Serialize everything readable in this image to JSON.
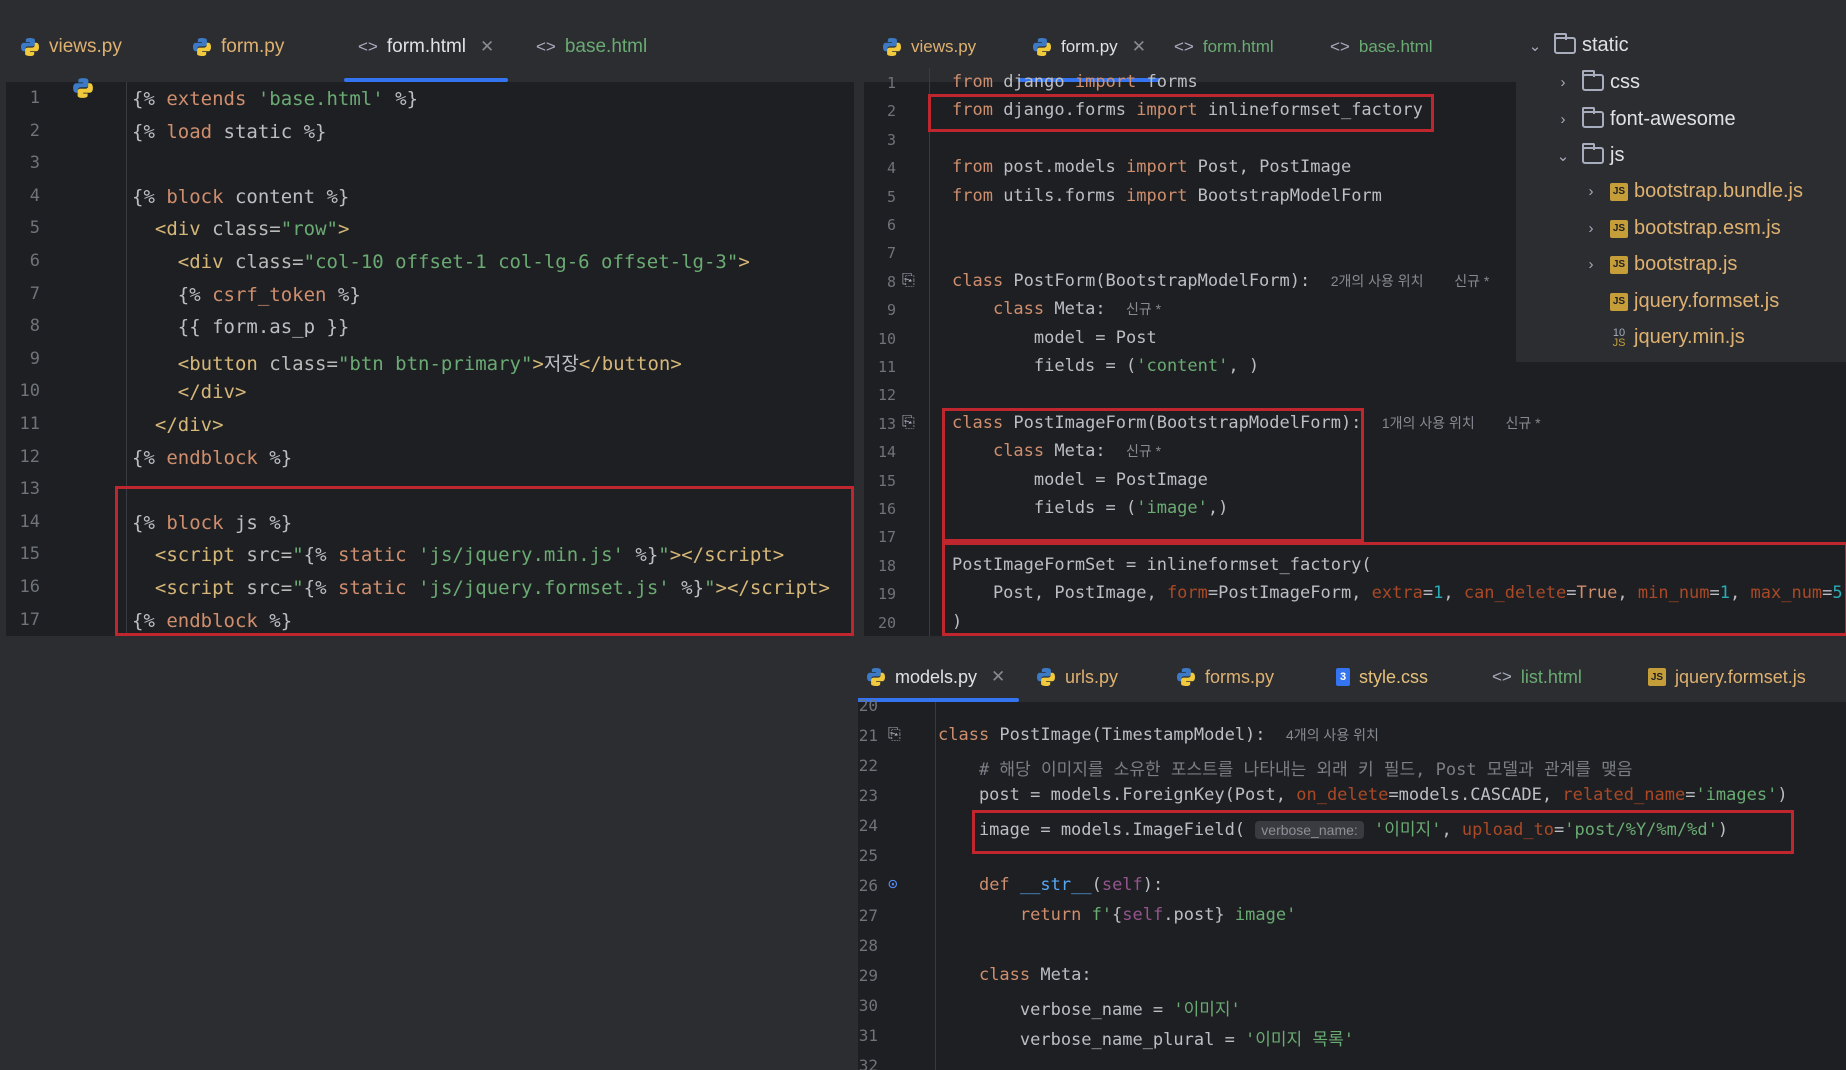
{
  "left": {
    "tabs": [
      {
        "label": "views.py",
        "icon": "python-icon"
      },
      {
        "label": "form.py",
        "icon": "python-icon"
      },
      {
        "label": "form.html",
        "icon": "html-icon",
        "active": true,
        "closable": true
      },
      {
        "label": "base.html",
        "icon": "html-icon"
      }
    ],
    "line_numbers": [
      "1",
      "2",
      "3",
      "4",
      "5",
      "6",
      "7",
      "8",
      "9",
      "10",
      "11",
      "12",
      "13",
      "14",
      "15",
      "16",
      "17"
    ]
  },
  "right_top": {
    "tabs": [
      {
        "label": "views.py",
        "icon": "python-icon"
      },
      {
        "label": "form.py",
        "icon": "python-icon",
        "active": true,
        "closable": true
      },
      {
        "label": "form.html",
        "icon": "html-icon"
      },
      {
        "label": "base.html",
        "icon": "html-icon"
      }
    ],
    "line_numbers": [
      "1",
      "2",
      "3",
      "4",
      "5",
      "6",
      "7",
      "8",
      "9",
      "10",
      "11",
      "12",
      "13",
      "14",
      "15",
      "16",
      "17",
      "18",
      "19",
      "20"
    ],
    "hints": {
      "postform_usages": "2개의 사용 위치",
      "postform_new": "신규 *",
      "meta_new_1": "신규 *",
      "postimageform_usages": "1개의 사용 위치",
      "postimageform_new": "신규 *",
      "meta_new_2": "신규 *"
    }
  },
  "file_tree": {
    "root": "static",
    "items": [
      {
        "label": "css",
        "type": "folder"
      },
      {
        "label": "font-awesome",
        "type": "folder"
      },
      {
        "label": "js",
        "type": "folder",
        "expanded": true
      },
      {
        "label": "bootstrap.bundle.js",
        "type": "js"
      },
      {
        "label": "bootstrap.esm.js",
        "type": "js"
      },
      {
        "label": "bootstrap.js",
        "type": "js"
      },
      {
        "label": "jquery.formset.js",
        "type": "js"
      },
      {
        "label": "jquery.min.js",
        "type": "minjs"
      }
    ]
  },
  "right_bottom": {
    "tabs": [
      {
        "label": "models.py",
        "icon": "python-icon",
        "active": true,
        "closable": true
      },
      {
        "label": "urls.py",
        "icon": "python-icon"
      },
      {
        "label": "forms.py",
        "icon": "python-icon"
      },
      {
        "label": "style.css",
        "icon": "css-icon"
      },
      {
        "label": "list.html",
        "icon": "html-icon"
      },
      {
        "label": "jquery.formset.js",
        "icon": "js-icon"
      }
    ],
    "line_numbers": [
      "20",
      "21",
      "22",
      "23",
      "24",
      "25",
      "26",
      "27",
      "28",
      "29",
      "30",
      "31",
      "32"
    ],
    "hints": {
      "postimage_usages": "4개의 사용 위치",
      "inlay_verbose_name": "verbose_name:"
    }
  },
  "colors": {
    "editor_bg": "#1e1f22",
    "tabbar_bg": "#2b2d30",
    "highlight_box": "#c0262d",
    "active_tab_underline": "#3574f0",
    "keyword": "#cf8e6d",
    "string": "#6aab73",
    "number": "#2aacb8",
    "param": "#aa4926"
  }
}
